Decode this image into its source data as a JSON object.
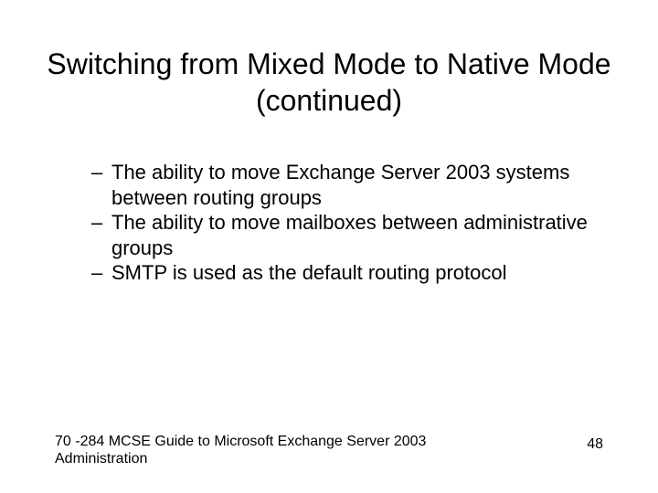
{
  "title": "Switching from Mixed Mode to Native Mode (continued)",
  "bullets": [
    "The ability to move Exchange Server 2003 systems between routing groups",
    "The ability to move mailboxes between administrative groups",
    "SMTP is used as the default routing protocol"
  ],
  "footer": {
    "source": "70 -284 MCSE Guide to Microsoft Exchange Server 2003 Administration",
    "page": "48"
  }
}
